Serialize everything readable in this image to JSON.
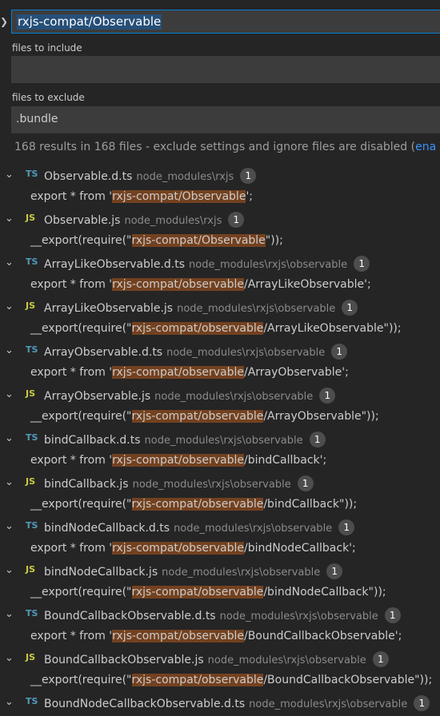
{
  "search": {
    "value": "rxjs-compat/Observable"
  },
  "include": {
    "label": "files to include",
    "value": ""
  },
  "exclude": {
    "label": "files to exclude",
    "value": ".bundle"
  },
  "summary": {
    "text": "168 results in 168 files - exclude settings and ignore files are disabled (",
    "link": "ena"
  },
  "results": [
    {
      "icon": "TS",
      "name": "Observable.d.ts",
      "path": "node_modules\\rxjs",
      "count": "1",
      "pre": "export * from '",
      "match": "rxjs-compat/Observable",
      "post": "';"
    },
    {
      "icon": "JS",
      "name": "Observable.js",
      "path": "node_modules\\rxjs",
      "count": "1",
      "pre": "__export(require(\"",
      "match": "rxjs-compat/Observable",
      "post": "\"));"
    },
    {
      "icon": "TS",
      "name": "ArrayLikeObservable.d.ts",
      "path": "node_modules\\rxjs\\observable",
      "count": "1",
      "pre": "export * from '",
      "match": "rxjs-compat/observable",
      "post": "/ArrayLikeObservable';"
    },
    {
      "icon": "JS",
      "name": "ArrayLikeObservable.js",
      "path": "node_modules\\rxjs\\observable",
      "count": "1",
      "pre": "__export(require(\"",
      "match": "rxjs-compat/observable",
      "post": "/ArrayLikeObservable\"));"
    },
    {
      "icon": "TS",
      "name": "ArrayObservable.d.ts",
      "path": "node_modules\\rxjs\\observable",
      "count": "1",
      "pre": "export * from '",
      "match": "rxjs-compat/observable",
      "post": "/ArrayObservable';"
    },
    {
      "icon": "JS",
      "name": "ArrayObservable.js",
      "path": "node_modules\\rxjs\\observable",
      "count": "1",
      "pre": "__export(require(\"",
      "match": "rxjs-compat/observable",
      "post": "/ArrayObservable\"));"
    },
    {
      "icon": "TS",
      "name": "bindCallback.d.ts",
      "path": "node_modules\\rxjs\\observable",
      "count": "1",
      "pre": "export * from '",
      "match": "rxjs-compat/observable",
      "post": "/bindCallback';"
    },
    {
      "icon": "JS",
      "name": "bindCallback.js",
      "path": "node_modules\\rxjs\\observable",
      "count": "1",
      "pre": "__export(require(\"",
      "match": "rxjs-compat/observable",
      "post": "/bindCallback\"));"
    },
    {
      "icon": "TS",
      "name": "bindNodeCallback.d.ts",
      "path": "node_modules\\rxjs\\observable",
      "count": "1",
      "pre": "export * from '",
      "match": "rxjs-compat/observable",
      "post": "/bindNodeCallback';"
    },
    {
      "icon": "JS",
      "name": "bindNodeCallback.js",
      "path": "node_modules\\rxjs\\observable",
      "count": "1",
      "pre": "__export(require(\"",
      "match": "rxjs-compat/observable",
      "post": "/bindNodeCallback\"));"
    },
    {
      "icon": "TS",
      "name": "BoundCallbackObservable.d.ts",
      "path": "node_modules\\rxjs\\observable",
      "count": "1",
      "pre": "export * from '",
      "match": "rxjs-compat/observable",
      "post": "/BoundCallbackObservable';"
    },
    {
      "icon": "JS",
      "name": "BoundCallbackObservable.js",
      "path": "node_modules\\rxjs\\observable",
      "count": "1",
      "pre": "__export(require(\"",
      "match": "rxjs-compat/observable",
      "post": "/BoundCallbackObservable\"));"
    },
    {
      "icon": "TS",
      "name": "BoundNodeCallbackObservable.d.ts",
      "path": "node_modules\\rxjs\\observable",
      "count": "1",
      "pre": "",
      "match": "",
      "post": ""
    }
  ],
  "icons": {
    "expanded": "chevron-down-icon",
    "toggle": "chevron-right-icon"
  },
  "colors": {
    "ts": "#519aba",
    "js": "#cbcb41",
    "highlight": "#73411f",
    "focus": "#007fd4"
  }
}
